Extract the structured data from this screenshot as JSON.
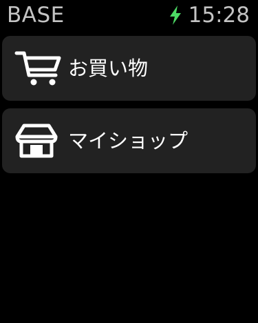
{
  "status": {
    "app_title": "BASE",
    "time": "15:28",
    "charging_color": "#4cd964"
  },
  "menu": {
    "items": [
      {
        "label": "お買い物",
        "icon": "shopping-cart-icon"
      },
      {
        "label": "マイショップ",
        "icon": "storefront-icon"
      }
    ]
  }
}
